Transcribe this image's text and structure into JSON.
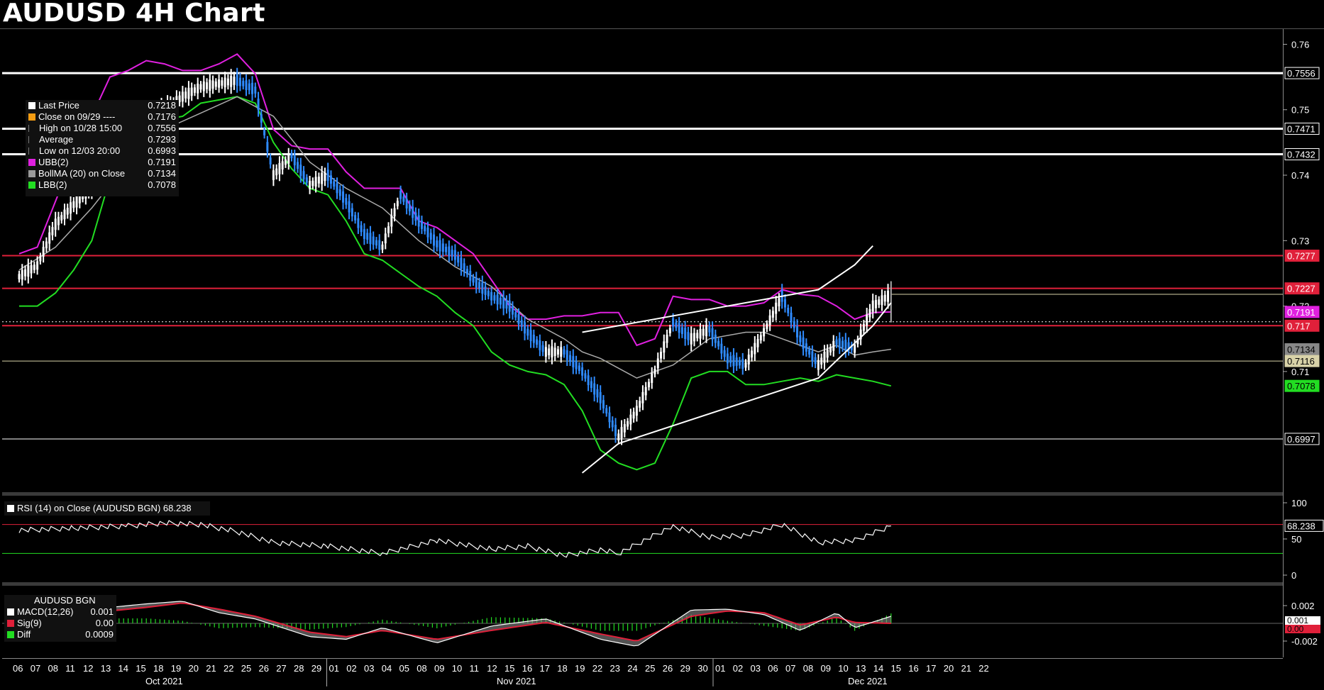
{
  "page": {
    "title": "AUDUSD 4H Chart"
  },
  "colors": {
    "upper_band": "#e020e0",
    "lower_band": "#22dd22",
    "ma": "#aaaaaa",
    "price_up": "#ffffff",
    "price_down": "#2f8bff",
    "resistance": "#e0203a",
    "support": "#ffffff"
  },
  "chart_data": [
    {
      "type": "line",
      "title": "AUDUSD 4H Chart",
      "ylim": [
        0.692,
        0.762
      ],
      "y_ticks": [
        "0.76",
        "0.75",
        "0.74",
        "0.73",
        "0.72",
        "0.71"
      ],
      "price_path": [
        [
          0,
          0.7245
        ],
        [
          1,
          0.7262
        ],
        [
          2,
          0.7325
        ],
        [
          3,
          0.7355
        ],
        [
          4,
          0.738
        ],
        [
          5,
          0.743
        ],
        [
          6,
          0.748
        ],
        [
          7,
          0.7495
        ],
        [
          8,
          0.75
        ],
        [
          9,
          0.752
        ],
        [
          10,
          0.7535
        ],
        [
          11,
          0.754
        ],
        [
          12,
          0.7545
        ],
        [
          13,
          0.753
        ],
        [
          14,
          0.74
        ],
        [
          15,
          0.743
        ],
        [
          16,
          0.7385
        ],
        [
          17,
          0.74
        ],
        [
          18,
          0.736
        ],
        [
          19,
          0.731
        ],
        [
          20,
          0.729
        ],
        [
          21,
          0.737
        ],
        [
          22,
          0.733
        ],
        [
          23,
          0.7295
        ],
        [
          24,
          0.7278
        ],
        [
          25,
          0.724
        ],
        [
          26,
          0.7215
        ],
        [
          27,
          0.72
        ],
        [
          28,
          0.716
        ],
        [
          29,
          0.713
        ],
        [
          30,
          0.713
        ],
        [
          31,
          0.71
        ],
        [
          32,
          0.706
        ],
        [
          33,
          0.7
        ],
        [
          34,
          0.704
        ],
        [
          35,
          0.71
        ],
        [
          36,
          0.7175
        ],
        [
          37,
          0.715
        ],
        [
          38,
          0.7165
        ],
        [
          39,
          0.712
        ],
        [
          40,
          0.711
        ],
        [
          41,
          0.716
        ],
        [
          42,
          0.7215
        ],
        [
          43,
          0.715
        ],
        [
          44,
          0.711
        ],
        [
          45,
          0.7145
        ],
        [
          46,
          0.7135
        ],
        [
          47,
          0.72
        ],
        [
          48,
          0.7218
        ]
      ],
      "upper_band": [
        [
          0,
          0.728
        ],
        [
          1,
          0.729
        ],
        [
          2,
          0.736
        ],
        [
          3,
          0.743
        ],
        [
          4,
          0.749
        ],
        [
          5,
          0.755
        ],
        [
          6,
          0.756
        ],
        [
          7,
          0.7575
        ],
        [
          8,
          0.757
        ],
        [
          9,
          0.756
        ],
        [
          10,
          0.756
        ],
        [
          11,
          0.757
        ],
        [
          12,
          0.7585
        ],
        [
          13,
          0.7555
        ],
        [
          14,
          0.747
        ],
        [
          15,
          0.7445
        ],
        [
          16,
          0.744
        ],
        [
          17,
          0.744
        ],
        [
          18,
          0.7405
        ],
        [
          19,
          0.738
        ],
        [
          20,
          0.738
        ],
        [
          21,
          0.738
        ],
        [
          22,
          0.733
        ],
        [
          23,
          0.732
        ],
        [
          24,
          0.73
        ],
        [
          25,
          0.728
        ],
        [
          26,
          0.724
        ],
        [
          27,
          0.72
        ],
        [
          28,
          0.718
        ],
        [
          29,
          0.718
        ],
        [
          30,
          0.7185
        ],
        [
          31,
          0.7185
        ],
        [
          32,
          0.719
        ],
        [
          33,
          0.719
        ],
        [
          34,
          0.714
        ],
        [
          35,
          0.715
        ],
        [
          36,
          0.7215
        ],
        [
          37,
          0.721
        ],
        [
          38,
          0.721
        ],
        [
          39,
          0.72
        ],
        [
          40,
          0.72
        ],
        [
          41,
          0.7205
        ],
        [
          42,
          0.7225
        ],
        [
          43,
          0.7218
        ],
        [
          44,
          0.7215
        ],
        [
          45,
          0.72
        ],
        [
          46,
          0.718
        ],
        [
          47,
          0.719
        ],
        [
          48,
          0.7191
        ]
      ],
      "ma": [
        [
          0,
          0.7255
        ],
        [
          2,
          0.729
        ],
        [
          4,
          0.735
        ],
        [
          6,
          0.742
        ],
        [
          8,
          0.747
        ],
        [
          10,
          0.7495
        ],
        [
          12,
          0.752
        ],
        [
          14,
          0.749
        ],
        [
          16,
          0.742
        ],
        [
          18,
          0.738
        ],
        [
          20,
          0.735
        ],
        [
          22,
          0.73
        ],
        [
          24,
          0.726
        ],
        [
          26,
          0.723
        ],
        [
          28,
          0.718
        ],
        [
          30,
          0.715
        ],
        [
          31,
          0.713
        ],
        [
          32,
          0.712
        ],
        [
          34,
          0.709
        ],
        [
          36,
          0.711
        ],
        [
          38,
          0.715
        ],
        [
          40,
          0.716
        ],
        [
          41,
          0.716
        ],
        [
          42,
          0.715
        ],
        [
          43,
          0.714
        ],
        [
          44,
          0.713
        ],
        [
          45,
          0.714
        ],
        [
          46,
          0.7125
        ],
        [
          47,
          0.713
        ],
        [
          48,
          0.7134
        ]
      ],
      "lower_band": [
        [
          0,
          0.72
        ],
        [
          1,
          0.72
        ],
        [
          2,
          0.722
        ],
        [
          3,
          0.7255
        ],
        [
          4,
          0.73
        ],
        [
          5,
          0.7395
        ],
        [
          6,
          0.74
        ],
        [
          7,
          0.7475
        ],
        [
          8,
          0.7485
        ],
        [
          9,
          0.749
        ],
        [
          10,
          0.751
        ],
        [
          11,
          0.7515
        ],
        [
          12,
          0.752
        ],
        [
          13,
          0.751
        ],
        [
          14,
          0.745
        ],
        [
          15,
          0.741
        ],
        [
          16,
          0.738
        ],
        [
          17,
          0.737
        ],
        [
          18,
          0.733
        ],
        [
          19,
          0.728
        ],
        [
          20,
          0.727
        ],
        [
          21,
          0.725
        ],
        [
          22,
          0.723
        ],
        [
          23,
          0.7215
        ],
        [
          24,
          0.719
        ],
        [
          25,
          0.717
        ],
        [
          26,
          0.713
        ],
        [
          27,
          0.711
        ],
        [
          28,
          0.71
        ],
        [
          29,
          0.7095
        ],
        [
          30,
          0.708
        ],
        [
          31,
          0.704
        ],
        [
          32,
          0.698
        ],
        [
          33,
          0.696
        ],
        [
          34,
          0.695
        ],
        [
          35,
          0.696
        ],
        [
          36,
          0.702
        ],
        [
          37,
          0.709
        ],
        [
          38,
          0.71
        ],
        [
          39,
          0.71
        ],
        [
          40,
          0.708
        ],
        [
          41,
          0.708
        ],
        [
          42,
          0.7085
        ],
        [
          43,
          0.709
        ],
        [
          44,
          0.7085
        ],
        [
          45,
          0.7095
        ],
        [
          46,
          0.709
        ],
        [
          47,
          0.7085
        ],
        [
          48,
          0.7078
        ]
      ],
      "channel_upper": [
        [
          31,
          0.716
        ],
        [
          44,
          0.7225
        ],
        [
          46,
          0.7263
        ],
        [
          47,
          0.7292
        ]
      ],
      "channel_lower": [
        [
          31,
          0.6945
        ],
        [
          33,
          0.699
        ],
        [
          44,
          0.709
        ],
        [
          47,
          0.717
        ],
        [
          48,
          0.7205
        ]
      ],
      "support_lines": [
        {
          "label": "0.7556",
          "value": 0.7556,
          "color": "#ffffff"
        },
        {
          "label": "0.7471",
          "value": 0.7471,
          "color": "#ffffff"
        },
        {
          "label": "0.7432",
          "value": 0.7432,
          "color": "#ffffff"
        },
        {
          "label": "0.7277",
          "value": 0.7277,
          "color": "#e0203a"
        },
        {
          "label": "0.7227",
          "value": 0.7227,
          "color": "#e0203a"
        },
        {
          "label": "0.717",
          "value": 0.717,
          "color": "#e0203a"
        },
        {
          "label": "0.7116",
          "value": 0.7116,
          "color": "#d8d2a8"
        },
        {
          "label": "0.6997",
          "value": 0.6997,
          "color": "#ffffff"
        }
      ],
      "axis_tags": [
        {
          "label": "0.7556",
          "value": 0.7556,
          "bg": "#000000",
          "fg": "#ffffff",
          "border": "#ffffff"
        },
        {
          "label": "0.7471",
          "value": 0.7471,
          "bg": "#000000",
          "fg": "#ffffff",
          "border": "#ffffff"
        },
        {
          "label": "0.7432",
          "value": 0.7432,
          "bg": "#000000",
          "fg": "#ffffff",
          "border": "#ffffff"
        },
        {
          "label": "0.7277",
          "value": 0.7277,
          "bg": "#e0203a",
          "fg": "#ffffff",
          "border": "#e0203a"
        },
        {
          "label": "0.7227",
          "value": 0.7227,
          "bg": "#e0203a",
          "fg": "#ffffff",
          "border": "#e0203a"
        },
        {
          "label": "0.7191",
          "value": 0.7191,
          "bg": "#e020e0",
          "fg": "#ffffff",
          "border": "#e020e0"
        },
        {
          "label": "0.717",
          "value": 0.717,
          "bg": "#e0203a",
          "fg": "#ffffff",
          "border": "#e0203a"
        },
        {
          "label": "0.7134",
          "value": 0.7134,
          "bg": "#888888",
          "fg": "#000000",
          "border": "#888888"
        },
        {
          "label": "0.7116",
          "value": 0.7116,
          "bg": "#d8d2a8",
          "fg": "#000000",
          "border": "#d8d2a8"
        },
        {
          "label": "0.7078",
          "value": 0.7078,
          "bg": "#22dd22",
          "fg": "#000000",
          "border": "#22dd22"
        },
        {
          "label": "0.6997",
          "value": 0.6997,
          "bg": "#000000",
          "fg": "#ffffff",
          "border": "#ffffff"
        }
      ]
    },
    {
      "type": "line",
      "title": "RSI (14) on Close (AUDUSD BGN) 68.238",
      "ylim": [
        0,
        100
      ],
      "y_ticks": [
        "100",
        "50",
        "0"
      ],
      "overbought": 70,
      "oversold": 30,
      "last": "68.238",
      "values": [
        [
          0,
          62
        ],
        [
          3,
          65
        ],
        [
          6,
          68
        ],
        [
          8,
          72
        ],
        [
          10,
          70
        ],
        [
          12,
          60
        ],
        [
          14,
          45
        ],
        [
          17,
          40
        ],
        [
          20,
          30
        ],
        [
          23,
          48
        ],
        [
          26,
          36
        ],
        [
          28,
          40
        ],
        [
          30,
          27
        ],
        [
          32,
          35
        ],
        [
          33,
          30
        ],
        [
          36,
          68
        ],
        [
          38,
          52
        ],
        [
          40,
          55
        ],
        [
          42,
          70
        ],
        [
          44,
          45
        ],
        [
          46,
          48
        ],
        [
          48,
          68
        ]
      ]
    },
    {
      "type": "line",
      "title": "AUDUSD BGN",
      "y_ticks": [
        "0.002",
        "-0.002"
      ],
      "macd": [
        [
          0,
          0.0003
        ],
        [
          4,
          0.0016
        ],
        [
          7,
          0.0022
        ],
        [
          9,
          0.0025
        ],
        [
          11,
          0.0012
        ],
        [
          13,
          0.0005
        ],
        [
          16,
          -0.0015
        ],
        [
          18,
          -0.0018
        ],
        [
          20,
          -0.0005
        ],
        [
          23,
          -0.0022
        ],
        [
          26,
          -0.0003
        ],
        [
          29,
          0.0005
        ],
        [
          32,
          -0.0018
        ],
        [
          34,
          -0.0026
        ],
        [
          37,
          0.0015
        ],
        [
          39,
          0.0016
        ],
        [
          41,
          0.001
        ],
        [
          43,
          -0.0008
        ],
        [
          45,
          0.0012
        ],
        [
          46,
          -0.0005
        ],
        [
          48,
          0.0008
        ]
      ],
      "sig": [
        [
          0,
          0.0
        ],
        [
          4,
          0.0012
        ],
        [
          7,
          0.0018
        ],
        [
          9,
          0.0023
        ],
        [
          11,
          0.0016
        ],
        [
          13,
          0.0008
        ],
        [
          16,
          -0.001
        ],
        [
          18,
          -0.0015
        ],
        [
          20,
          -0.0008
        ],
        [
          23,
          -0.0018
        ],
        [
          26,
          -0.0008
        ],
        [
          29,
          0.0001
        ],
        [
          32,
          -0.0012
        ],
        [
          34,
          -0.002
        ],
        [
          37,
          0.0008
        ],
        [
          39,
          0.0014
        ],
        [
          41,
          0.0012
        ],
        [
          43,
          -0.0002
        ],
        [
          45,
          0.0007
        ],
        [
          46,
          0.0001
        ],
        [
          48,
          0.0
        ]
      ],
      "legend": [
        {
          "swatch": "#ffffff",
          "label": "MACD(12,26)",
          "value": "0.001"
        },
        {
          "swatch": "#e0203a",
          "label": "Sig(9)",
          "value": "0.00"
        },
        {
          "swatch": "#22dd22",
          "label": "Diff",
          "value": "0.0009"
        }
      ],
      "axis_tags": [
        {
          "label": "0.001",
          "bg": "#ffffff",
          "fg": "#000000"
        },
        {
          "label": "0.00",
          "bg": "#e0203a",
          "fg": "#000000"
        }
      ]
    }
  ],
  "legend": [
    {
      "swatch": "#ffffff",
      "label": "Last Price",
      "value": "0.7218"
    },
    {
      "swatch": "#f39c12",
      "label": "Close on 09/29 ----",
      "value": "0.7176"
    },
    {
      "swatch": "",
      "label": "High on 10/28 15:00",
      "value": "0.7556"
    },
    {
      "swatch": "",
      "label": "Average",
      "value": "0.7293"
    },
    {
      "swatch": "",
      "label": "Low on 12/03 20:00",
      "value": "0.6993"
    },
    {
      "swatch": "#e020e0",
      "label": "UBB(2)",
      "value": "0.7191"
    },
    {
      "swatch": "#999999",
      "label": "BollMA (20)  on Close",
      "value": "0.7134"
    },
    {
      "swatch": "#22dd22",
      "label": "LBB(2)",
      "value": "0.7078"
    }
  ],
  "x_axis": {
    "days": [
      "06",
      "07",
      "08",
      "11",
      "12",
      "13",
      "14",
      "15",
      "18",
      "19",
      "20",
      "21",
      "22",
      "25",
      "26",
      "27",
      "28",
      "29",
      "01",
      "02",
      "03",
      "04",
      "05",
      "08",
      "09",
      "10",
      "11",
      "12",
      "15",
      "16",
      "17",
      "18",
      "19",
      "22",
      "23",
      "24",
      "25",
      "26",
      "29",
      "30",
      "01",
      "02",
      "03",
      "06",
      "07",
      "08",
      "09",
      "10",
      "13",
      "14",
      "15",
      "16",
      "17",
      "20",
      "21",
      "22"
    ],
    "months": [
      {
        "label": "Oct 2021",
        "day_index": 8
      },
      {
        "label": "Nov 2021",
        "day_index": 28
      },
      {
        "label": "Dec 2021",
        "day_index": 48
      }
    ],
    "month_breaks": [
      18,
      40
    ]
  }
}
